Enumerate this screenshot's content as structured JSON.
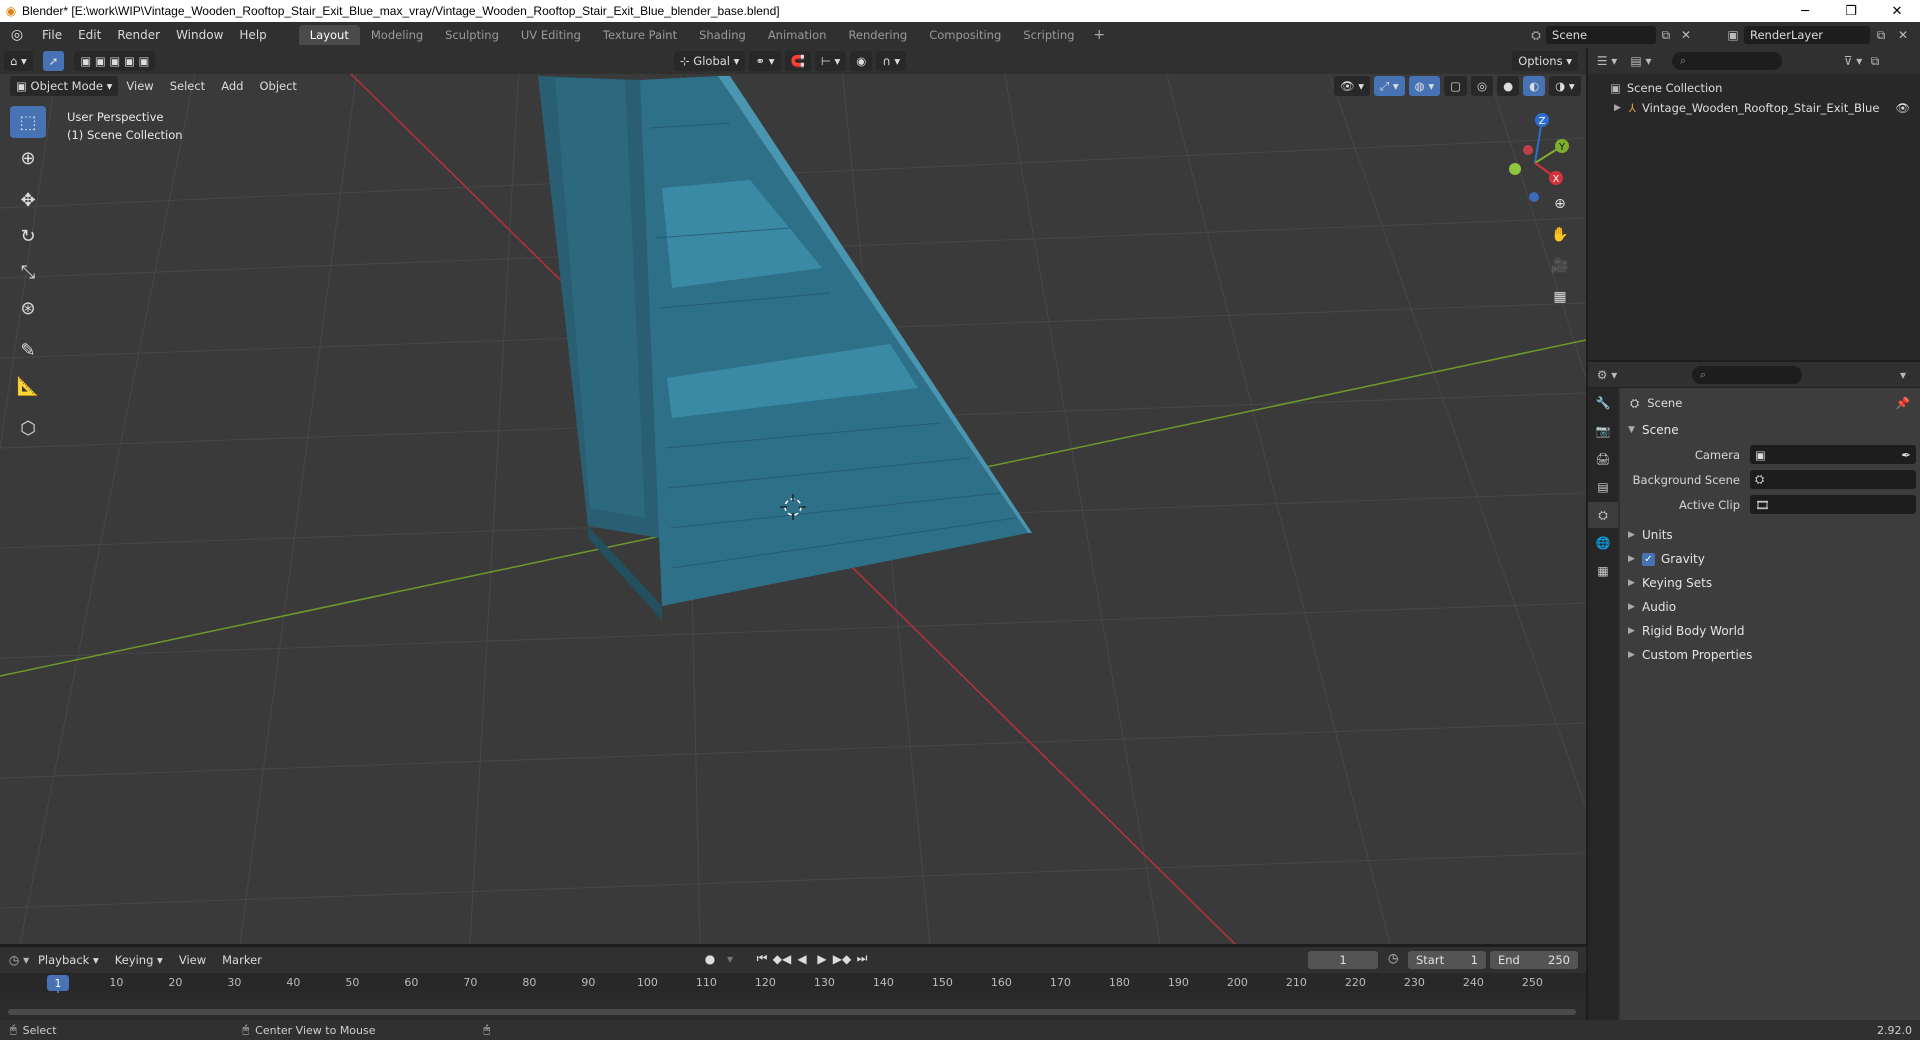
{
  "window": {
    "title": "Blender* [E:\\work\\WIP\\Vintage_Wooden_Rooftop_Stair_Exit_Blue_max_vray/Vintage_Wooden_Rooftop_Stair_Exit_Blue_blender_base.blend]"
  },
  "menu": [
    "File",
    "Edit",
    "Render",
    "Window",
    "Help"
  ],
  "workspaces": [
    "Layout",
    "Modeling",
    "Sculpting",
    "UV Editing",
    "Texture Paint",
    "Shading",
    "Animation",
    "Rendering",
    "Compositing",
    "Scripting"
  ],
  "active_workspace": "Layout",
  "scene_name": "Scene",
  "render_layer": "RenderLayer",
  "viewport": {
    "mode": "Object Mode",
    "menus": [
      "View",
      "Select",
      "Add",
      "Object"
    ],
    "transform_orientation": "Global",
    "options_label": "Options",
    "info_line1": "User Perspective",
    "info_line2": "(1) Scene Collection",
    "gizmo_axes": [
      "X",
      "Y",
      "Z"
    ]
  },
  "tools": [
    "select-box-icon",
    "cursor-icon",
    "move-icon",
    "rotate-icon",
    "scale-icon",
    "transform-icon",
    "annotate-icon",
    "measure-icon",
    "add-cube-icon"
  ],
  "outliner": {
    "root": "Scene Collection",
    "items": [
      "Vintage_Wooden_Rooftop_Stair_Exit_Blue"
    ]
  },
  "properties": {
    "context": "Scene",
    "panel_title": "Scene",
    "rows": [
      {
        "label": "Camera",
        "value": ""
      },
      {
        "label": "Background Scene",
        "value": ""
      },
      {
        "label": "Active Clip",
        "value": ""
      }
    ],
    "subpanels": [
      "Units",
      "Gravity",
      "Keying Sets",
      "Audio",
      "Rigid Body World",
      "Custom Properties"
    ],
    "gravity_enabled": true
  },
  "timeline": {
    "menus": [
      "Playback",
      "Keying",
      "View",
      "Marker"
    ],
    "current_frame": "1",
    "start_label": "Start",
    "start": "1",
    "end_label": "End",
    "end": "250",
    "ticks": [
      "1",
      "10",
      "20",
      "30",
      "40",
      "50",
      "60",
      "70",
      "80",
      "90",
      "100",
      "110",
      "120",
      "130",
      "140",
      "150",
      "160",
      "170",
      "180",
      "190",
      "200",
      "210",
      "220",
      "230",
      "240",
      "250"
    ]
  },
  "statusbar": {
    "left": "Select",
    "middle": "Center View to Mouse",
    "version": "2.92.0"
  },
  "colors": {
    "accent": "#4772b3",
    "grid_bg": "#3a3a3a",
    "x_axis": "#b8303a",
    "y_axis": "#6f9a2a",
    "object": "#2e6f86"
  }
}
